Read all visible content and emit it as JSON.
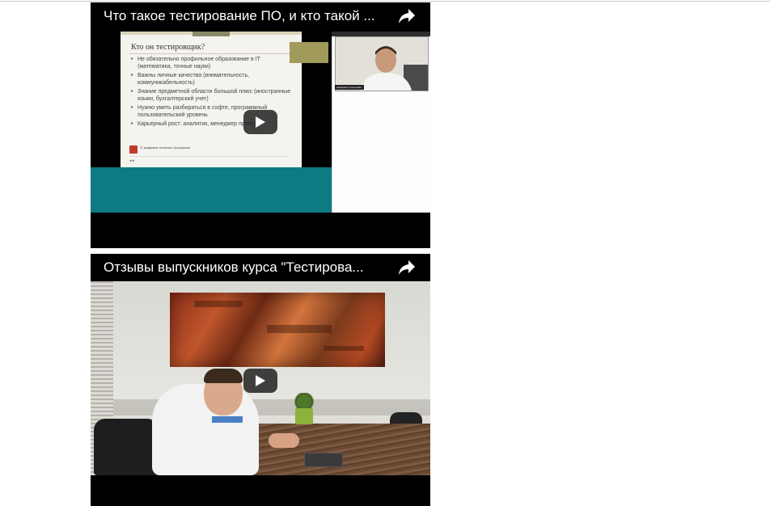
{
  "videos": [
    {
      "title": "Что такое тестирование ПО, и кто такой ...",
      "share_icon": "share-arrow-icon",
      "play_icon": "play-icon",
      "slide": {
        "heading": "Кто он тестировщик?",
        "bullets": [
          "Не обязательно профильное образование в IT (математика, точные науки)",
          "Важны личные качества (внимательность, коммуникабельность)",
          "Знание предметной области большой плюс (иностранные языки, бухгалтерский учет)",
          "Нужно уметь разбираться в софте, программный пользовательский уровень",
          "Карьерный рост: аналитик, менеджер проекта"
        ],
        "logo_text": "IT академия Алексея Сухорукова",
        "nav": "◂ ▸"
      },
      "webcam_label": "Академия Сухорукова"
    },
    {
      "title": "Отзывы выпускников курса \"Тестирова...",
      "share_icon": "share-arrow-icon",
      "play_icon": "play-icon"
    }
  ],
  "colors": {
    "player_bg": "#000000",
    "teal_block": "#0d7b84",
    "play_button": "#212121",
    "title_text": "#ffffff"
  }
}
